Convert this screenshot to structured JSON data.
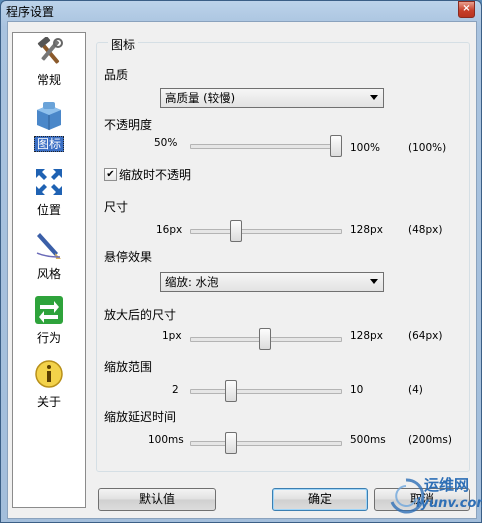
{
  "window": {
    "title": "程序设置",
    "close_glyph": "×"
  },
  "sidebar": {
    "items": [
      {
        "label": "常规",
        "icon": "tools-icon",
        "active": false
      },
      {
        "label": "图标",
        "icon": "dock-box-icon",
        "active": true
      },
      {
        "label": "位置",
        "icon": "move-arrows-icon",
        "active": false
      },
      {
        "label": "风格",
        "icon": "brush-icon",
        "active": false
      },
      {
        "label": "行为",
        "icon": "swap-arrows-icon",
        "active": false
      },
      {
        "label": "关于",
        "icon": "info-icon",
        "active": false
      }
    ]
  },
  "icons_panel": {
    "group_title": "图标",
    "quality": {
      "label": "品质",
      "value": "高质量 (较慢)"
    },
    "opacity": {
      "label": "不透明度",
      "min": "50%",
      "max": "100%",
      "current": "(100%)",
      "position": 1.0
    },
    "zoom_opaque": {
      "label": "缩放时不透明",
      "checked": true,
      "check_glyph": "✔"
    },
    "size": {
      "label": "尺寸",
      "min": "16px",
      "max": "128px",
      "current": "(48px)",
      "position": 0.286
    },
    "hover_effect": {
      "label": "悬停效果",
      "value": "缩放: 水泡"
    },
    "zoomed_size": {
      "label": "放大后的尺寸",
      "min": "1px",
      "max": "128px",
      "current": "(64px)",
      "position": 0.496
    },
    "zoom_range": {
      "label": "缩放范围",
      "min": "2",
      "max": "10",
      "current": "(4)",
      "position": 0.25
    },
    "zoom_delay": {
      "label": "缩放延迟时间",
      "min": "100ms",
      "max": "500ms",
      "current": "(200ms)",
      "position": 0.25
    }
  },
  "buttons": {
    "defaults": "默认值",
    "ok": "确定",
    "cancel": "取消"
  },
  "watermark": {
    "line1": "运维网",
    "line2": "iyunv.com"
  }
}
